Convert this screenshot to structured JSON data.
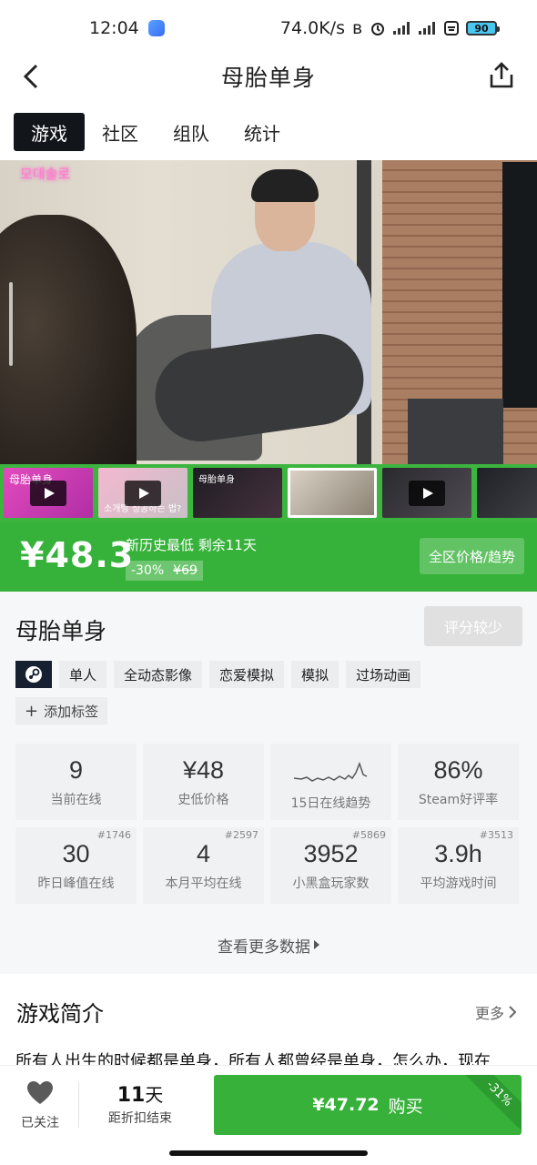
{
  "status": {
    "time": "12:04",
    "speed": "74.0K/s",
    "battery": "90"
  },
  "nav": {
    "title": "母胎单身"
  },
  "tabs": [
    {
      "label": "游戏",
      "active": true
    },
    {
      "label": "社区",
      "active": false
    },
    {
      "label": "组队",
      "active": false
    },
    {
      "label": "统计",
      "active": false
    }
  ],
  "hero": {
    "watermark": "모대솔로"
  },
  "thumbs": [
    {
      "label": "母胎单身",
      "video": true
    },
    {
      "label": "소개팅 성공하는 법?",
      "video": true
    },
    {
      "label": "母胎单身",
      "video": false
    },
    {
      "label": "",
      "video": false
    },
    {
      "label": "",
      "video": true
    },
    {
      "label": "",
      "video": false
    }
  ],
  "price": {
    "current": "¥48.3",
    "note": "新历史最低 剩余11天",
    "discount": "-30%",
    "original": "¥69",
    "region_button": "全区价格/趋势"
  },
  "game": {
    "title": "母胎单身",
    "score_button": "评分较少",
    "tags": [
      "单人",
      "全动态影像",
      "恋爱模拟",
      "模拟",
      "过场动画"
    ],
    "add_tag": "添加标签"
  },
  "stats": [
    {
      "value": "9",
      "label": "当前在线",
      "rank": ""
    },
    {
      "value": "¥48",
      "label": "史低价格",
      "rank": ""
    },
    {
      "value": "",
      "label": "15日在线趋势",
      "rank": ""
    },
    {
      "value": "86%",
      "label": "Steam好评率",
      "rank": ""
    },
    {
      "value": "30",
      "label": "昨日峰值在线",
      "rank": "#1746"
    },
    {
      "value": "4",
      "label": "本月平均在线",
      "rank": "#2597"
    },
    {
      "value": "3952",
      "label": "小黑盒玩家数",
      "rank": "#5869"
    },
    {
      "value": "3.9h",
      "label": "平均游戏时间",
      "rank": "#3513"
    }
  ],
  "more_data": "查看更多数据",
  "intro": {
    "heading": "游戏简介",
    "more": "更多",
    "text": "所有人出生的时候都是单身，所有人都曾经是单身，怎么办，现在"
  },
  "bottom": {
    "follow_label": "已关注",
    "days": "11",
    "days_unit": "天",
    "countdown_label": "距折扣结束",
    "buy_price": "¥47.72",
    "buy_label": "购买",
    "ribbon": "-31%"
  },
  "colors": {
    "accent_green": "#36b23a",
    "dark": "#12161b"
  }
}
